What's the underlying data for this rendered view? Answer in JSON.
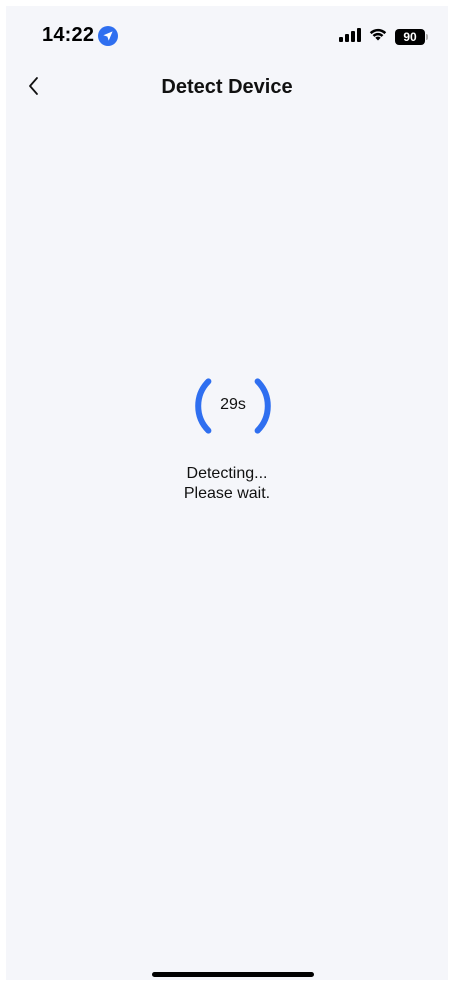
{
  "status_bar": {
    "time": "14:22",
    "battery_level": "90",
    "signal_icon": "signal-bars-icon",
    "wifi_icon": "wifi-icon",
    "location_icon": "location-arrow-icon"
  },
  "nav": {
    "back_icon": "chevron-left-icon",
    "title": "Detect Device"
  },
  "detection": {
    "countdown": "29s",
    "status_line_1": "Detecting...",
    "status_line_2": "Please wait."
  },
  "colors": {
    "accent": "#2f6ff0",
    "background": "#f5f6fa"
  }
}
